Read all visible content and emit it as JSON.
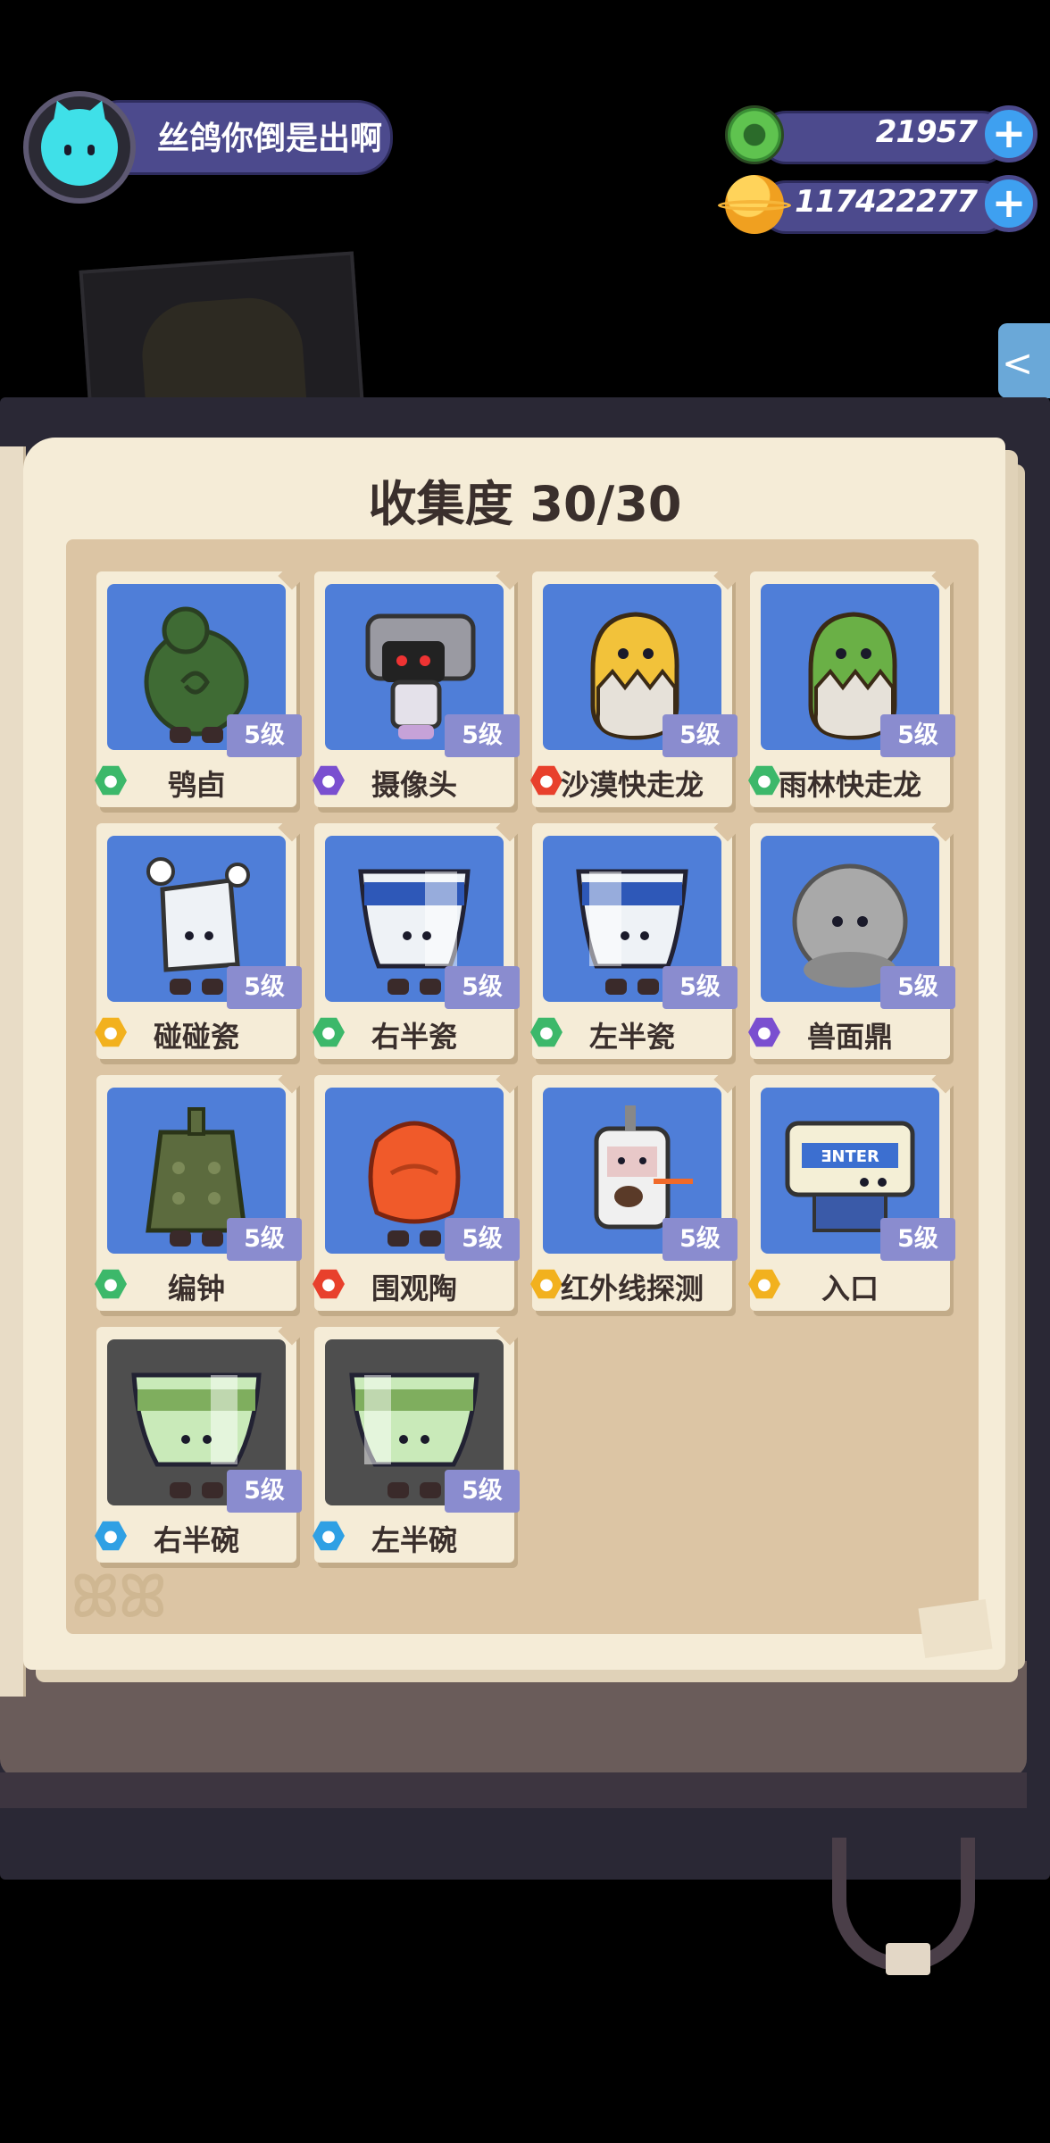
{
  "player": {
    "name": "丝鸽你倒是出啊"
  },
  "currencies": [
    {
      "amount": "21957",
      "icon": "green-gem-icon",
      "color": "#4caf50"
    },
    {
      "amount": "117422277",
      "icon": "gold-planet-coin-icon",
      "color": "#f5a623"
    }
  ],
  "collection": {
    "title": "收集度 30/30",
    "items": [
      {
        "name": "鸮卣",
        "level": "5级",
        "rarity": "green",
        "body_color": "#3f6b34"
      },
      {
        "name": "摄像头",
        "level": "5级",
        "rarity": "purple",
        "body_color": "#9a9aa2"
      },
      {
        "name": "沙漠快走龙",
        "level": "5级",
        "rarity": "red",
        "body_color": "#f2c23a"
      },
      {
        "name": "雨林快走龙",
        "level": "5级",
        "rarity": "green",
        "body_color": "#6ab046"
      },
      {
        "name": "碰碰瓷",
        "level": "5级",
        "rarity": "gold",
        "body_color": "#eef2f6"
      },
      {
        "name": "右半瓷",
        "level": "5级",
        "rarity": "green",
        "body_color": "#eef2f6"
      },
      {
        "name": "左半瓷",
        "level": "5级",
        "rarity": "green",
        "body_color": "#eef2f6"
      },
      {
        "name": "兽面鼎",
        "level": "5级",
        "rarity": "purple",
        "body_color": "#a9a9a9"
      },
      {
        "name": "编钟",
        "level": "5级",
        "rarity": "green",
        "body_color": "#5c6b3e"
      },
      {
        "name": "围观陶",
        "level": "5级",
        "rarity": "red",
        "body_color": "#f05a2a"
      },
      {
        "name": "红外线探测",
        "level": "5级",
        "rarity": "gold",
        "body_color": "#f0f0f0"
      },
      {
        "name": "入口",
        "level": "5级",
        "rarity": "gold",
        "body_color": "#f4efd6"
      },
      {
        "name": "右半碗",
        "level": "5级",
        "rarity": "blue",
        "body_color": "#c9eab9"
      },
      {
        "name": "左半碗",
        "level": "5级",
        "rarity": "blue",
        "body_color": "#c9eab9"
      }
    ]
  },
  "rarity_colors": {
    "green": "#3cb86a",
    "purple": "#7a4fd0",
    "red": "#e8402c",
    "gold": "#f2b11e",
    "blue": "#2fa0e4"
  },
  "icons": {
    "plus": "plus-icon",
    "share": "share-icon",
    "avatar": "cat-avatar-icon"
  }
}
